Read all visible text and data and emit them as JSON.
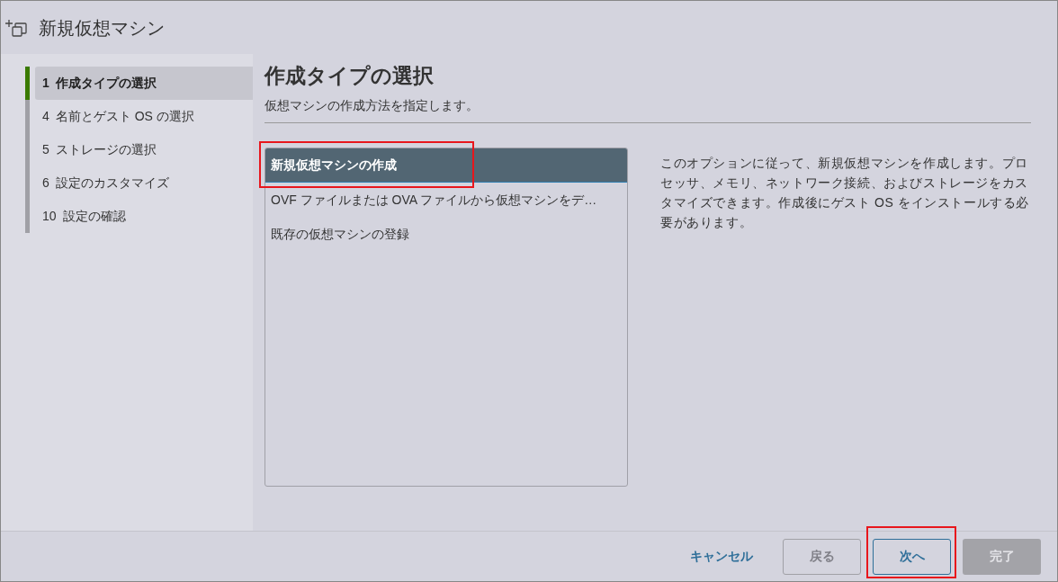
{
  "window": {
    "title": "新規仮想マシン"
  },
  "steps": [
    {
      "number": "1",
      "label": "作成タイプの選択",
      "selected": true
    },
    {
      "number": "4",
      "label": "名前とゲスト OS の選択",
      "selected": false
    },
    {
      "number": "5",
      "label": "ストレージの選択",
      "selected": false
    },
    {
      "number": "6",
      "label": "設定のカスタマイズ",
      "selected": false
    },
    {
      "number": "10",
      "label": "設定の確認",
      "selected": false
    }
  ],
  "page": {
    "title": "作成タイプの選択",
    "subtitle": "仮想マシンの作成方法を指定します。"
  },
  "options": [
    {
      "label": "新規仮想マシンの作成",
      "selected": true,
      "highlighted": true
    },
    {
      "label": "OVF ファイルまたは OVA ファイルから仮想マシンをデ…",
      "selected": false,
      "highlighted": false
    },
    {
      "label": "既存の仮想マシンの登録",
      "selected": false,
      "highlighted": false
    }
  ],
  "description": "このオプションに従って、新規仮想マシンを作成します。プロセッサ、メモリ、ネットワーク接続、およびストレージをカスタマイズできます。作成後にゲスト OS をインストールする必要があります。",
  "buttons": [
    {
      "kind": "link",
      "label": "キャンセル",
      "disabled": false,
      "highlighted": false
    },
    {
      "kind": "outline",
      "label": "戻る",
      "disabled": true,
      "highlighted": false
    },
    {
      "kind": "outline",
      "label": "次へ",
      "disabled": false,
      "highlighted": true
    },
    {
      "kind": "solid",
      "label": "完了",
      "disabled": true,
      "highlighted": false
    }
  ]
}
